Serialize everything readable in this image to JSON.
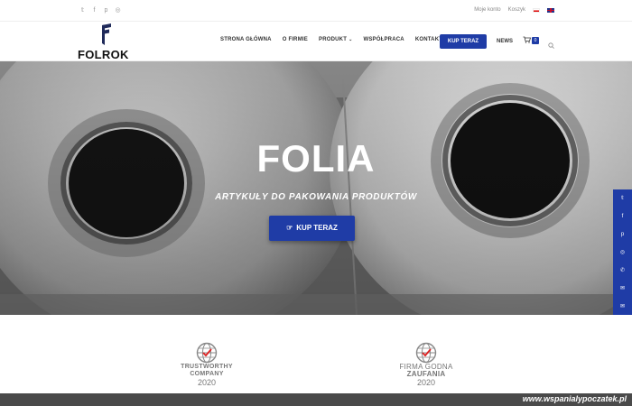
{
  "topbar": {
    "social_icons": [
      "twitter-icon",
      "facebook-icon",
      "pinterest-icon",
      "instagram-icon"
    ],
    "my_account": "Moje konto",
    "cart_link": "Koszyk",
    "languages": [
      "pl-flag",
      "en-flag"
    ]
  },
  "header": {
    "logo_text": "FOLROK",
    "nav": [
      {
        "label": "STRONA GŁÓWNA"
      },
      {
        "label": "O FIRMIE"
      },
      {
        "label": "PRODUKT"
      },
      {
        "label": "WSPÓŁPRACA"
      },
      {
        "label": "KONTAKT"
      }
    ],
    "buy_button": "KUP TERAZ",
    "news": "NEWS",
    "cart_count": "0"
  },
  "hero": {
    "title": "FOLIA",
    "subtitle": "ARTYKUŁY DO PAKOWANIA PRODUKTÓW",
    "button": "KUP TERAZ"
  },
  "sidebar_icons": [
    "twitter-icon",
    "facebook-icon",
    "pinterest-icon",
    "instagram-icon",
    "phone-icon",
    "mail-icon",
    "mail-icon"
  ],
  "badges": [
    {
      "line1": "TRUSTWORTHY",
      "line2": "COMPANY",
      "year": "2020"
    },
    {
      "line1": "FIRMA GODNA",
      "line2": "ZAUFANIA",
      "year": "2020"
    }
  ],
  "watermark": "www.wspanialypoczatek.pl",
  "colors": {
    "accent": "#1f3ca6",
    "dark": "#4a4a4a"
  }
}
